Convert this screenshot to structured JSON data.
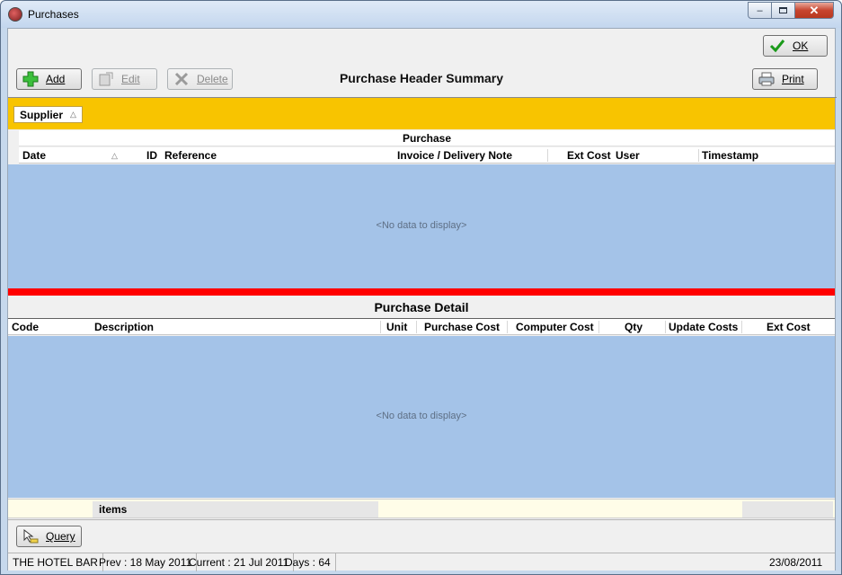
{
  "window": {
    "title": "Purchases",
    "min_icon": "minimize-icon",
    "max_icon": "maximize-icon",
    "close_icon": "close-icon"
  },
  "toolbar": {
    "ok_label": "OK",
    "add_label": "Add",
    "edit_label": "Edit",
    "delete_label": "Delete",
    "print_label": "Print",
    "summary_title": "Purchase Header Summary"
  },
  "header_grid": {
    "group_by": "Supplier",
    "band_label": "Purchase",
    "columns": [
      "Date",
      "ID",
      "Reference",
      "Invoice / Delivery Note",
      "Ext Cost",
      "User",
      "Timestamp"
    ],
    "empty_text": "<No data to display>"
  },
  "detail": {
    "title": "Purchase Detail",
    "columns": [
      "Code",
      "Description",
      "Unit",
      "Purchase Cost",
      "Computer Cost",
      "Qty",
      "Update Costs",
      "Ext Cost"
    ],
    "empty_text": "<No data to display>",
    "footer_items_label": "items"
  },
  "query": {
    "label": "Query"
  },
  "statusbar": {
    "venue": "THE HOTEL BAR",
    "prev": "Prev : 18 May 2011",
    "current": "Current : 21 Jul 2011",
    "days": "Days : 64",
    "date": "23/08/2011"
  },
  "colors": {
    "group_panel": "#f8c400",
    "grid_bg": "#a4c3e8",
    "divider": "#ff0000",
    "footer_bg": "#fffde8"
  }
}
